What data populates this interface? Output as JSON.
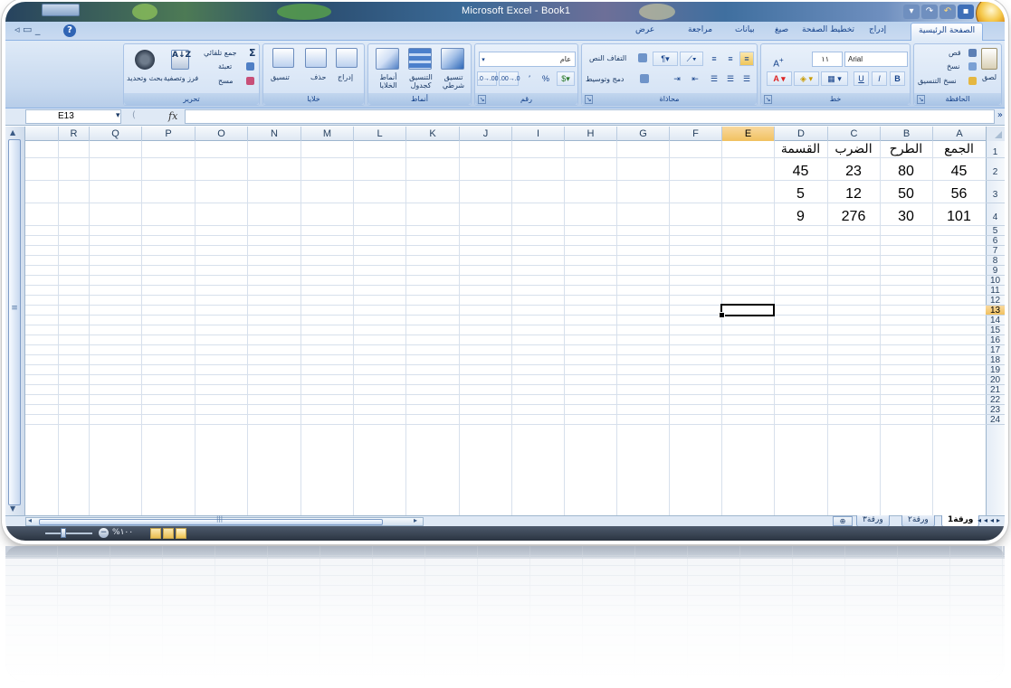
{
  "window": {
    "title": "Microsoft Excel - Book1"
  },
  "tabs": [
    {
      "label": "الصفحة الرئيسية",
      "active": true
    },
    {
      "label": "إدراج"
    },
    {
      "label": "تخطيط الصفحة"
    },
    {
      "label": "صيغ"
    },
    {
      "label": "بيانات"
    },
    {
      "label": "مراجعة"
    },
    {
      "label": "عرض"
    }
  ],
  "ribbon": {
    "clipboard": {
      "label": "الحافظة",
      "paste": "لصق",
      "cut": "قص",
      "copy": "نسخ",
      "format_painter": "نسخ التنسيق"
    },
    "font": {
      "label": "خط",
      "name": "Arial",
      "size": "١١",
      "bold": "B",
      "italic": "I",
      "underline": "U"
    },
    "alignment": {
      "label": "محاذاة",
      "wrap_text": "التفاف النص",
      "merge_center": "دمج وتوسيط"
    },
    "number": {
      "label": "رقم",
      "format": "عام",
      "percent": "%",
      "comma": "٬"
    },
    "styles": {
      "label": "أنماط",
      "conditional": "تنسيق شرطي",
      "format_table": "التنسيق كجدول",
      "cell_styles": "أنماط الخلايا"
    },
    "cells": {
      "label": "خلايا",
      "insert": "إدراج",
      "delete": "حذف",
      "format": "تنسيق"
    },
    "editing": {
      "label": "تحرير",
      "autosum": "جمع تلقائي",
      "fill": "تعبئة",
      "clear": "مسح",
      "sort_filter": "فرز وتصفية",
      "find_select": "بحث وتحديد"
    }
  },
  "formula_bar": {
    "name_box": "E13",
    "fx": "fx",
    "value": ""
  },
  "grid": {
    "columns": [
      "A",
      "B",
      "C",
      "D",
      "E",
      "F",
      "G",
      "H",
      "I",
      "J",
      "K",
      "L",
      "M",
      "N",
      "O",
      "P",
      "Q",
      "R"
    ],
    "selected_column": "E",
    "rows": [
      "1",
      "2",
      "3",
      "4",
      "5",
      "6",
      "7",
      "8",
      "9",
      "10",
      "11",
      "12",
      "13",
      "14",
      "15",
      "16",
      "17",
      "18",
      "19",
      "20",
      "21",
      "22",
      "23",
      "24"
    ],
    "selected_row": "13",
    "active_cell": "E13",
    "data": {
      "A1": "الجمع",
      "B1": "الطرح",
      "C1": "الضرب",
      "D1": "القسمة",
      "A2": "45",
      "B2": "80",
      "C2": "23",
      "D2": "45",
      "A3": "56",
      "B3": "50",
      "C3": "12",
      "D3": "5",
      "A4": "101",
      "B4": "30",
      "C4": "276",
      "D4": "9"
    }
  },
  "sheets": [
    {
      "label": "ورقة1",
      "active": true
    },
    {
      "label": "ورقة٢"
    },
    {
      "label": "ورقة٣"
    }
  ],
  "status": {
    "zoom": "%١٠٠"
  },
  "accent": "#15428b",
  "selection_color": "#f1c15f"
}
